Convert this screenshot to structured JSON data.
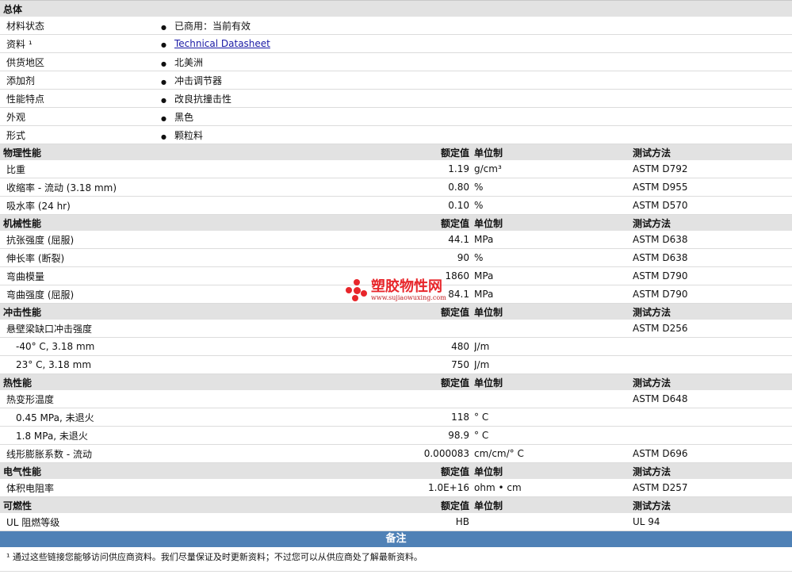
{
  "general": {
    "title": "总体",
    "rows": [
      {
        "label": "材料状态",
        "value": "已商用：当前有效"
      },
      {
        "label": "资料 ¹",
        "value": "Technical Datasheet",
        "link": true
      },
      {
        "label": "供货地区",
        "value": "北美洲"
      },
      {
        "label": "添加剂",
        "value": "冲击调节器"
      },
      {
        "label": "性能特点",
        "value": "改良抗撞击性"
      },
      {
        "label": "外观",
        "value": "黑色"
      },
      {
        "label": "形式",
        "value": "颗粒料"
      }
    ]
  },
  "columns": {
    "value": "额定值",
    "unit": "单位制",
    "method": "测试方法"
  },
  "sections": [
    {
      "title": "物理性能",
      "rows": [
        {
          "label": "比重",
          "value": "1.19",
          "unit": "g/cm³",
          "method": "ASTM D792"
        },
        {
          "label": "收缩率 - 流动 (3.18 mm)",
          "value": "0.80",
          "unit": "%",
          "method": "ASTM D955"
        },
        {
          "label": "吸水率 (24 hr)",
          "value": "0.10",
          "unit": "%",
          "method": "ASTM D570"
        }
      ]
    },
    {
      "title": "机械性能",
      "rows": [
        {
          "label": "抗张强度 (屈服)",
          "value": "44.1",
          "unit": "MPa",
          "method": "ASTM D638"
        },
        {
          "label": "伸长率 (断裂)",
          "value": "90",
          "unit": "%",
          "method": "ASTM D638"
        },
        {
          "label": "弯曲模量",
          "value": "1860",
          "unit": "MPa",
          "method": "ASTM D790"
        },
        {
          "label": "弯曲强度 (屈服)",
          "value": "84.1",
          "unit": "MPa",
          "method": "ASTM D790"
        }
      ]
    },
    {
      "title": "冲击性能",
      "rows": [
        {
          "label": "悬壁梁缺口冲击强度",
          "value": "",
          "unit": "",
          "method": "ASTM D256"
        },
        {
          "label": "-40° C, 3.18 mm",
          "value": "480",
          "unit": "J/m",
          "method": "",
          "sub": true
        },
        {
          "label": "23° C, 3.18 mm",
          "value": "750",
          "unit": "J/m",
          "method": "",
          "sub": true
        }
      ]
    },
    {
      "title": "热性能",
      "rows": [
        {
          "label": "热变形温度",
          "value": "",
          "unit": "",
          "method": "ASTM D648"
        },
        {
          "label": "0.45 MPa, 未退火",
          "value": "118",
          "unit": "° C",
          "method": "",
          "sub": true
        },
        {
          "label": "1.8 MPa, 未退火",
          "value": "98.9",
          "unit": "° C",
          "method": "",
          "sub": true
        },
        {
          "label": "线形膨胀系数 - 流动",
          "value": "0.000083",
          "unit": "cm/cm/° C",
          "method": "ASTM D696"
        }
      ]
    },
    {
      "title": "电气性能",
      "rows": [
        {
          "label": "体积电阻率",
          "value": "1.0E+16",
          "unit": "ohm • cm",
          "method": "ASTM D257"
        }
      ]
    },
    {
      "title": "可燃性",
      "rows": [
        {
          "label": "UL 阻燃等级",
          "value": "HB",
          "unit": "",
          "method": "UL 94"
        }
      ]
    }
  ],
  "notes": {
    "title": "备注",
    "text": "¹ 通过这些链接您能够访问供应商资料。我们尽量保证及时更新资料；不过您可以从供应商处了解最新资料。"
  },
  "watermark": {
    "name": "塑胶物性网",
    "url": "www.sujiaowuxing.com"
  }
}
